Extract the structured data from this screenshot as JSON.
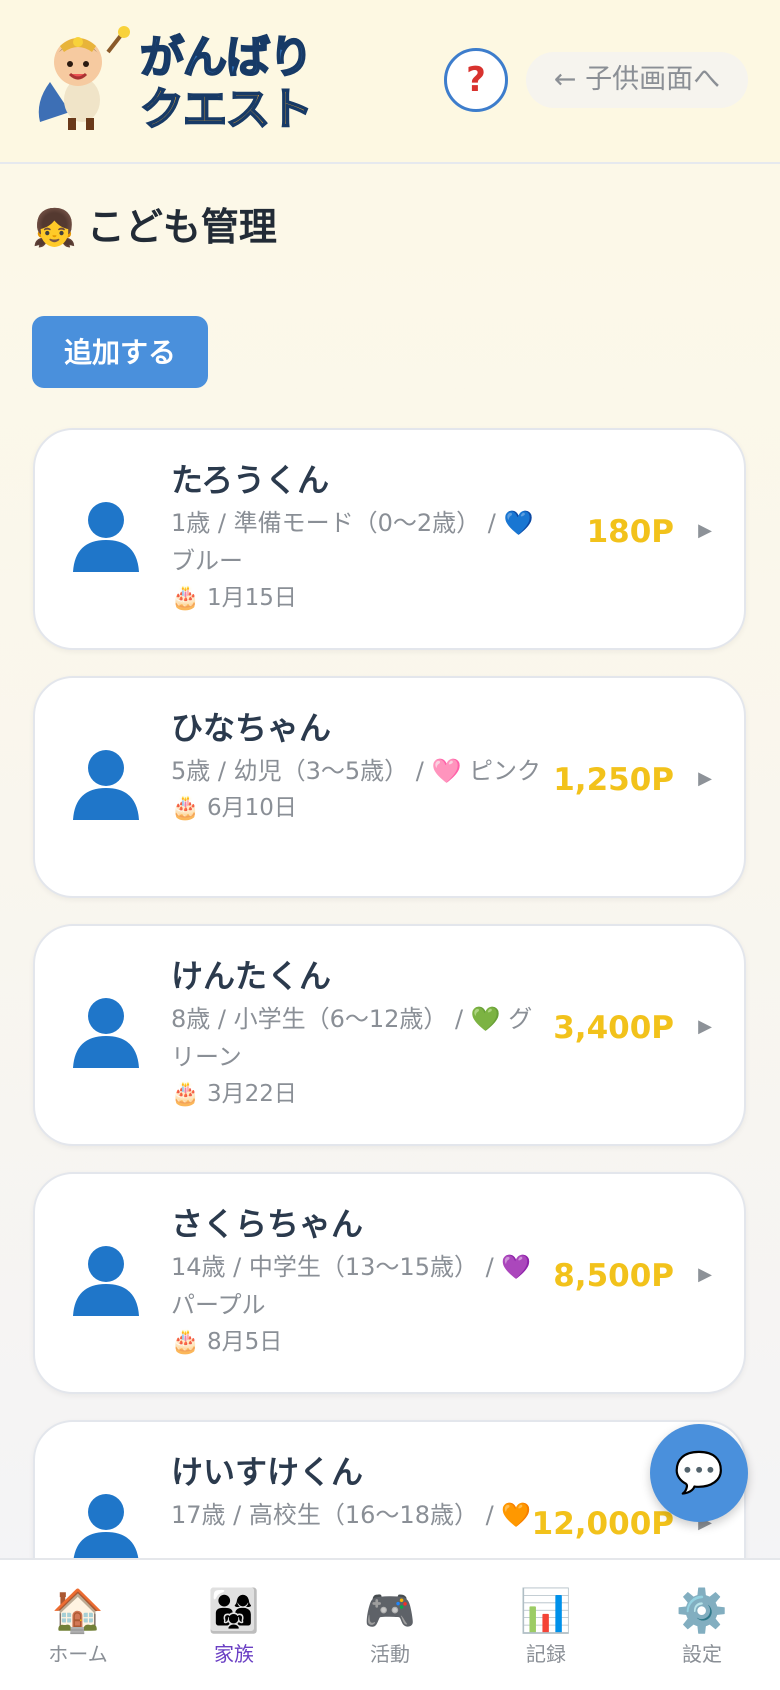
{
  "header": {
    "logo_line1": "がんばり",
    "logo_line2": "クエスト",
    "help_label": "?",
    "back_label": "← 子供画面へ"
  },
  "page": {
    "title_emoji": "👧",
    "title": "こども管理",
    "add_label": "追加する"
  },
  "children": [
    {
      "name": "たろうくん",
      "detail": "1歳 / 準備モード（0〜2歳） / 💙 ブルー",
      "birthday": "🎂 1月15日",
      "points": "180P"
    },
    {
      "name": "ひなちゃん",
      "detail": "5歳 / 幼児（3〜5歳） / 🩷 ピンク",
      "birthday": "🎂 6月10日",
      "points": "1,250P"
    },
    {
      "name": "けんたくん",
      "detail": "8歳 / 小学生（6〜12歳） / 💚 グリーン",
      "birthday": "🎂 3月22日",
      "points": "3,400P"
    },
    {
      "name": "さくらちゃん",
      "detail": "14歳 / 中学生（13〜15歳） / 💜 パープル",
      "birthday": "🎂 8月5日",
      "points": "8,500P"
    },
    {
      "name": "けいすけくん",
      "detail": "17歳 / 高校生（16〜18歳） / 🧡",
      "birthday": "",
      "points": "12,000P"
    }
  ],
  "chevron": "▶",
  "chat_icon": "💬",
  "nav": [
    {
      "icon": "🏠",
      "label": "ホーム",
      "active": false
    },
    {
      "icon": "👨‍👩‍👧",
      "label": "家族",
      "active": true
    },
    {
      "icon": "🎮",
      "label": "活動",
      "active": false
    },
    {
      "icon": "📊",
      "label": "記録",
      "active": false
    },
    {
      "icon": "⚙️",
      "label": "設定",
      "active": false
    }
  ],
  "colors": {
    "accent": "#4a90dc",
    "points": "#f2c21b",
    "nav_active": "#6a3fc4"
  }
}
